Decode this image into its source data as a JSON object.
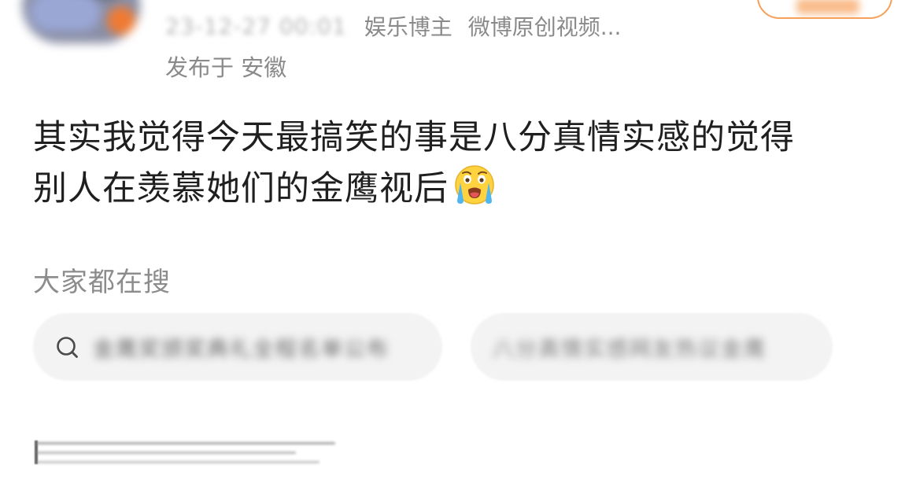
{
  "post": {
    "meta": {
      "time": "23-12-27 00:01",
      "author_tag": "娱乐博主",
      "source": "微博原创视频..."
    },
    "location": "发布于 安徽",
    "text_line_1": "其实我觉得今天最搞笑的事是八分真情实感的觉得",
    "text_line_2": "别人在羡慕她们的金鹰视后",
    "emoji": "crying-face"
  },
  "trending": {
    "title": "大家都在搜",
    "items": [
      {
        "text": "金鹰奖颁奖典礼全程名单公布"
      },
      {
        "text": "八分真情实感网友热议金鹰"
      }
    ]
  },
  "colors": {
    "accent": "#f6a05a",
    "muted_text": "#8a8a8a",
    "pill_bg": "#f3f3f3"
  }
}
